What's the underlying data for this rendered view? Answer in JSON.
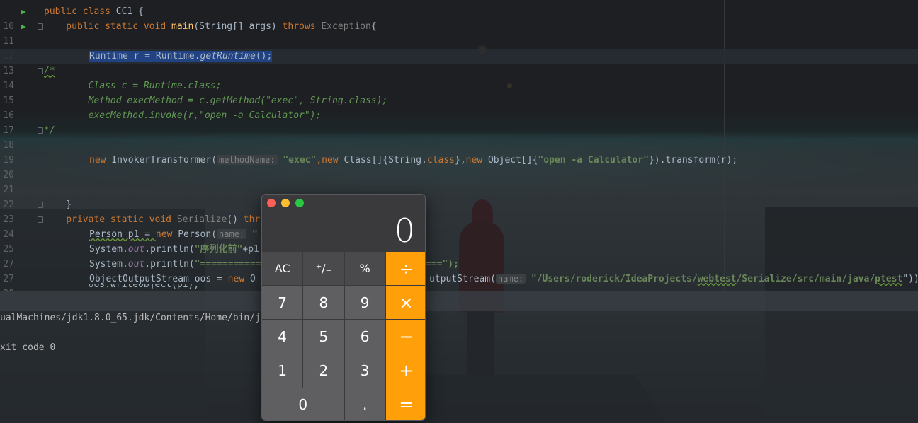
{
  "editor": {
    "lines": {
      "10": "10",
      "11": "11",
      "12": "12",
      "13": "13",
      "14": "14",
      "15": "15",
      "16": "16",
      "17": "17",
      "18": "18",
      "19": "19",
      "20": "20",
      "21": "21",
      "22": "22",
      "23": "23",
      "24": "24",
      "25": "25",
      "27": "27",
      "28": "28"
    },
    "l10": {
      "a": "public class ",
      "b": "CC1 {"
    },
    "l11": {
      "a": "    public static void ",
      "b": "main",
      "c": "(String[] args) ",
      "d": "throws ",
      "e": "Exception",
      "f": "{"
    },
    "l13": {
      "a": "Runtime r = Runtime.",
      "b": "getRuntime",
      "c": "();"
    },
    "l14": "/*",
    "l15": "        Class c = Runtime.class;",
    "l16": "        Method execMethod = c.getMethod(\"exec\", String.class);",
    "l17": "        execMethod.invoke(r,\"open -a Calculator\");",
    "l18": "*/",
    "l20": {
      "a": "new ",
      "b": "InvokerTransformer(",
      "hint": "methodName:",
      "c": "\"exec\"",
      "d": ",",
      "e": "new ",
      "f": "Class[]{String.",
      "g": "class",
      "h": "},",
      "i": "new ",
      "j": "Object[]{",
      "k": "\"open -a Calculator\"",
      "l": "}).transform(r);"
    },
    "l23": "    }",
    "l24": {
      "a": "    private static void ",
      "b": "Serialize",
      "c": "() ",
      "d": "thr"
    },
    "l25": {
      "a": "Person p1 = ",
      "b": "new ",
      "c": "Person(",
      "hint": "name:",
      "d": " \""
    },
    "l26": {
      "a": "System.",
      "b": "out",
      "c": ".println(",
      "d": "\"序列化前\"",
      "e": "+p1"
    },
    "l27": {
      "a": "System.",
      "b": "out",
      "c": ".println(",
      "d": "\"===========",
      "e": "===\");"
    },
    "l28": {
      "a": "ObjectOutputStream oos = ",
      "b": "new ",
      "c": "O",
      "d": "utputStream(",
      "hint": "name:",
      "e": "\"/Users/roderick/IdeaProjects/",
      "f": "webtest",
      "g": "/Serialize/src/main/java/",
      "h": "ptest",
      "i": "\"));"
    },
    "l29": "        oos.writeObject(p1);"
  },
  "terminal": {
    "line1": "ualMachines/jdk1.8.0_65.jdk/Contents/Home/bin/j",
    "line2": "xit code 0"
  },
  "calculator": {
    "display": "0",
    "keys": [
      "AC",
      "⁺∕₋",
      "%",
      "÷",
      "7",
      "8",
      "9",
      "×",
      "4",
      "5",
      "6",
      "−",
      "1",
      "2",
      "3",
      "+",
      "0",
      ".",
      "="
    ],
    "colors": {
      "operator": "#ff9f0a",
      "close": "#ff5f57",
      "minimize": "#febc2e",
      "zoom": "#28c840"
    }
  }
}
